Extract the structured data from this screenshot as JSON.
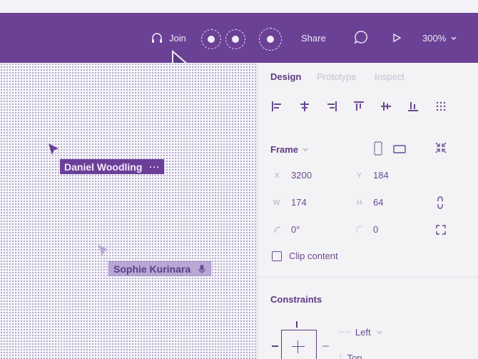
{
  "topbar": {
    "join_label": "Join",
    "share_label": "Share",
    "zoom_label": "300%",
    "icons": [
      "headphones-icon",
      "comment-icon",
      "play-icon",
      "chevron-down-icon"
    ]
  },
  "canvas": {
    "user1": {
      "name": "Daniel Woodling",
      "more": "···"
    },
    "user2": {
      "name": "Sophie Kurinara"
    }
  },
  "panel": {
    "tabs": [
      "Design",
      "Prototype",
      "Inspect"
    ],
    "frame": {
      "title": "Frame"
    },
    "fields": {
      "x_label": "X",
      "x_value": "3200",
      "y_label": "Y",
      "y_value": "184",
      "w_label": "W",
      "w_value": "174",
      "h_label": "H",
      "h_value": "64",
      "rotation_value": "0°",
      "radius_value": "0"
    },
    "clip_content": "Clip content",
    "constraints": {
      "title": "Constraints",
      "horizontal": "Left",
      "vertical": "Top"
    }
  },
  "colors": {
    "accent": "#6a4195",
    "text": "#5d3b85"
  }
}
